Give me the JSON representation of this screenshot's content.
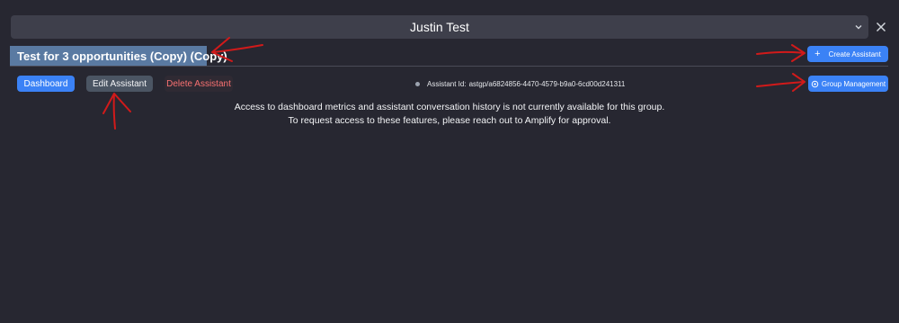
{
  "header": {
    "group_name": "Justin Test",
    "chevron_icon": "chevron-down-icon",
    "close_icon": "close-icon"
  },
  "assistant": {
    "name": "Test for 3 opportunities (Copy) (Copy)",
    "id_label": "Assistant Id:",
    "id_value": "astgp/a6824856-4470-4579-b9a0-6cd00d241311"
  },
  "toolbar": {
    "create_label": "Create Assistant",
    "create_icon": "plus-icon",
    "dashboard_label": "Dashboard",
    "edit_label": "Edit Assistant",
    "delete_label": "Delete Assistant",
    "group_management_label": "Group Management",
    "group_management_icon": "gear-icon"
  },
  "notice": {
    "line1": "Access to dashboard metrics and assistant conversation history is not currently available for this group.",
    "line2": "To request access to these features, please reach out to Amplify for approval."
  },
  "colors": {
    "background": "#272731",
    "primary_button": "#3b82f6",
    "secondary_button": "#4b5563",
    "danger_text": "#f87171",
    "title_bar": "#5a7aa2",
    "annotation_arrow": "#d11a1a"
  }
}
